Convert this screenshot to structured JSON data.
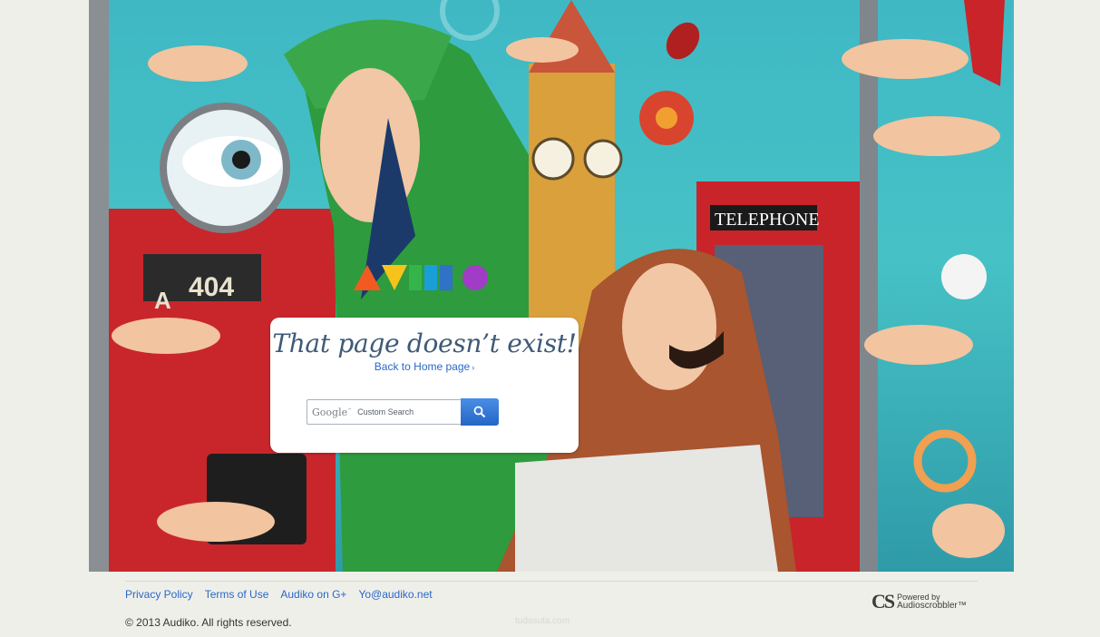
{
  "hero": {
    "phone_box_sign": "TELEPHONE",
    "bus_number": "404",
    "bus_letter": "A",
    "logo_text": "AUDIKO"
  },
  "card": {
    "title": "That page doesn’t exist!",
    "back_link": "Back to Home page",
    "back_chevron": "›",
    "search": {
      "brand": "Google",
      "brand_tm": "™",
      "placeholder": "Custom Search",
      "button_icon": "search-icon"
    }
  },
  "footer": {
    "links": [
      "Privacy Policy",
      "Terms of Use",
      "Audiko on G+",
      "Yo@audiko.net"
    ],
    "copyright": "© 2013 Audiko. All rights reserved.",
    "powered_by": {
      "logo": "CS",
      "line1": "Powered by",
      "line2": "Audioscrobbler™"
    },
    "watermark": "tudasuta.com"
  },
  "colors": {
    "page_bg": "#efefea",
    "link": "#2a68c7",
    "title": "#3f5a77",
    "search_button": "#2f74d4"
  }
}
